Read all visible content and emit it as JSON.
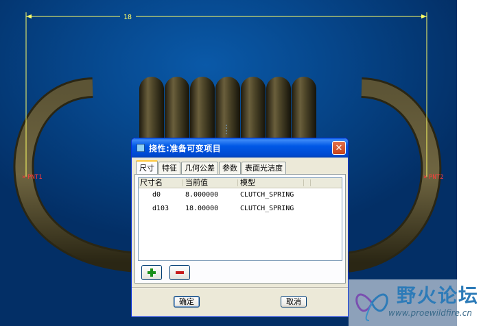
{
  "cad": {
    "dimension_value": "18",
    "point_left": "PNT1",
    "point_right": "PNT2",
    "point_marker": "×"
  },
  "dialog": {
    "title": "挠性:准备可变项目",
    "close_icon": "✕",
    "tabs": [
      "尺寸",
      "特征",
      "几何公差",
      "参数",
      "表面光洁度"
    ],
    "active_tab": "尺寸",
    "columns": [
      "尺寸名",
      "当前值",
      "模型"
    ],
    "rows": [
      {
        "name": "d0",
        "value": "8.000000",
        "model": "CLUTCH_SPRING"
      },
      {
        "name": "d103",
        "value": "18.00000",
        "model": "CLUTCH_SPRING"
      }
    ],
    "add_icon": "plus-icon",
    "remove_icon": "minus-icon",
    "ok_label": "确定",
    "cancel_label": "取消"
  },
  "watermark": {
    "title": "野火论坛",
    "url": "www.proewildfire.cn"
  },
  "colors": {
    "background": "#06478c",
    "dimension": "#ffff66",
    "point_label": "#ff3b3b",
    "titlebar": "#0058e6",
    "spring": "#4a432a"
  }
}
